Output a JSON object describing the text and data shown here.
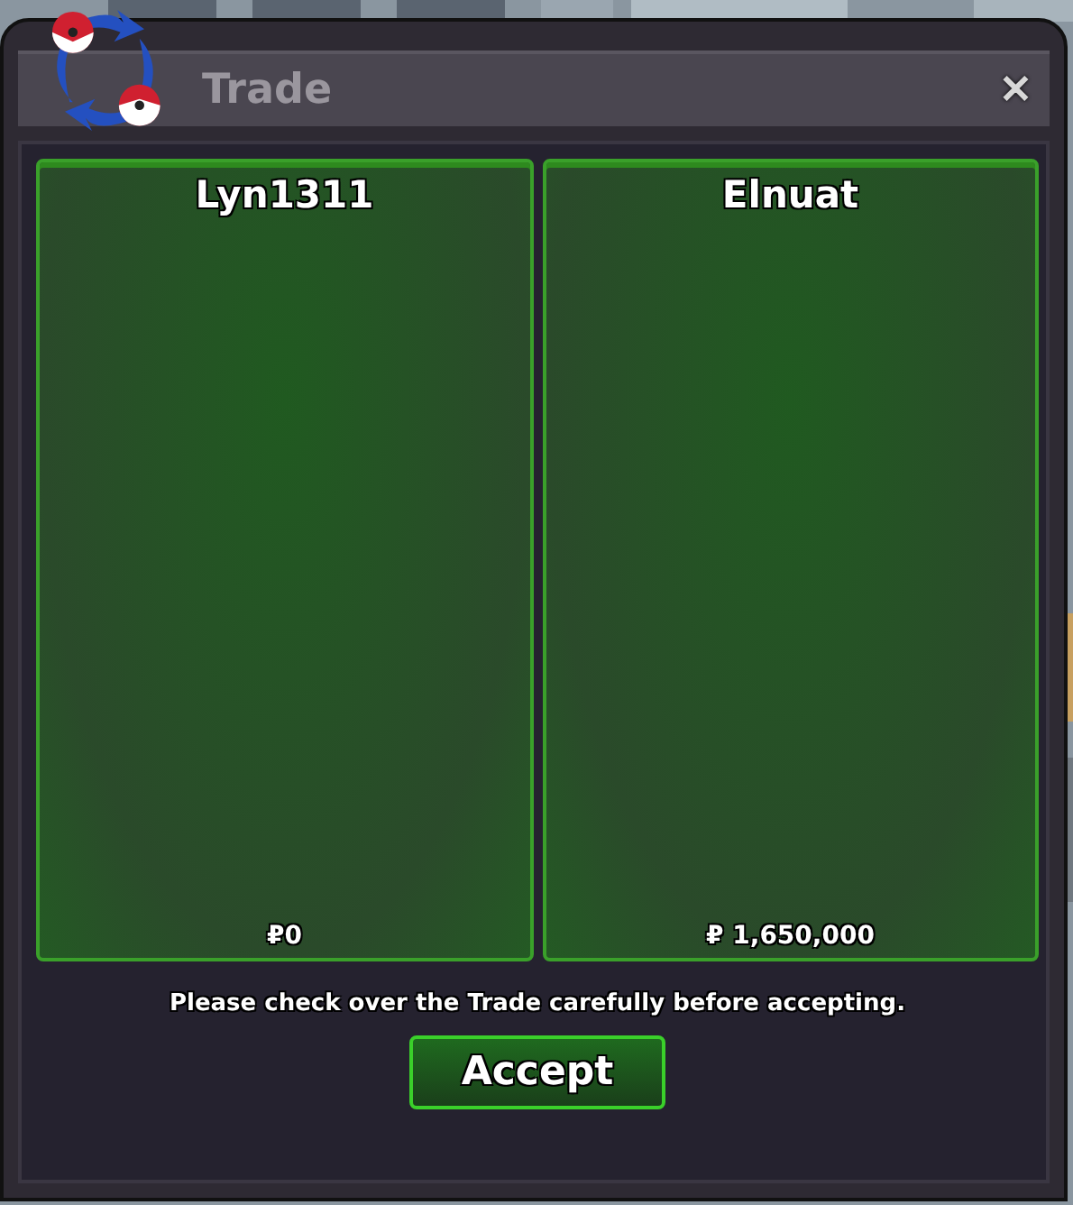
{
  "window": {
    "title": "Trade",
    "close": "✕"
  },
  "panels": [
    {
      "name": "Lyn1311",
      "money": "₽0"
    },
    {
      "name": "Elnuat",
      "money": "₽ 1,650,000"
    }
  ],
  "message": "Please check over the Trade carefully before accepting.",
  "buttons": [
    "Accept"
  ]
}
